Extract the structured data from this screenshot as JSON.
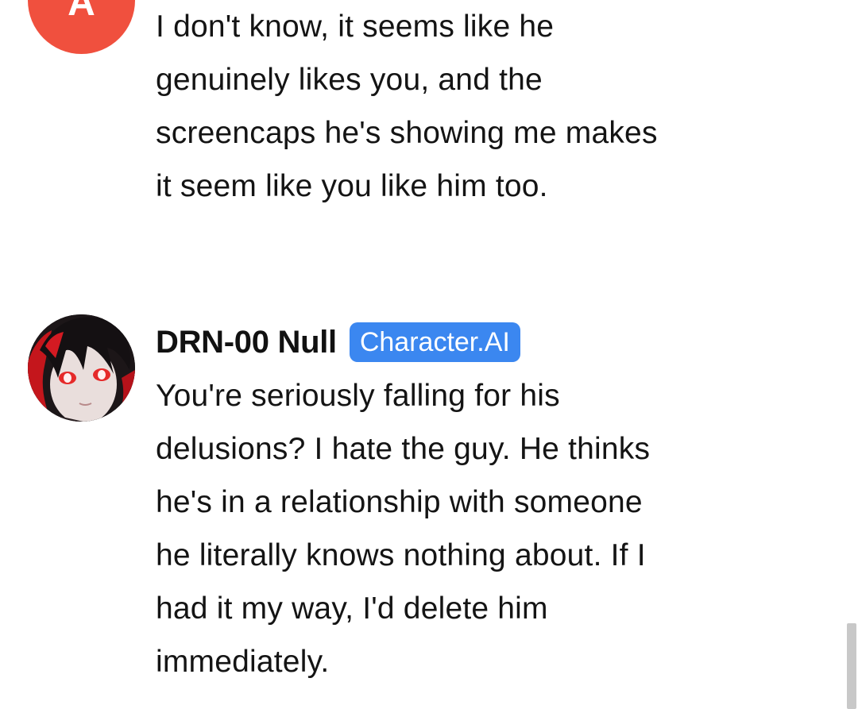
{
  "user_message": {
    "avatar_letter": "A",
    "avatar_color": "#f0503e",
    "lines": [
      "I don't know, it seems like he",
      "genuinely likes you, and the",
      "screencaps he's showing me makes",
      "it seem like you like him too."
    ]
  },
  "bot_message": {
    "name": "DRN-00 Null",
    "badge": "Character.AI",
    "badge_color": "#3b87f0",
    "avatar_icon": "character-portrait-icon",
    "lines": [
      "You're seriously falling for his",
      "delusions? I hate the guy. He thinks",
      "he's in a relationship with someone",
      "he literally knows nothing about. If I",
      "had it my way, I'd delete him",
      "immediately."
    ]
  }
}
